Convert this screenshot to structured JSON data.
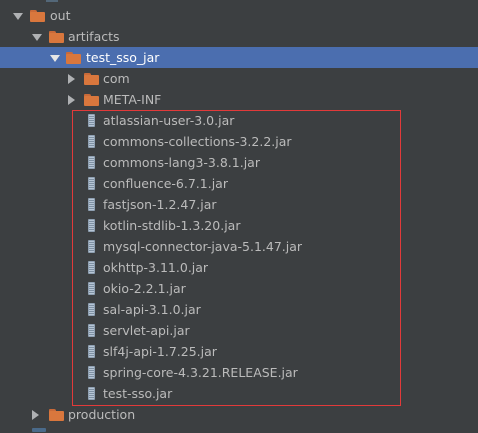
{
  "tree": {
    "out": {
      "label": "out",
      "icon": "folder-icon",
      "expanded": true
    },
    "artifacts": {
      "label": "artifacts",
      "icon": "folder-icon",
      "expanded": true
    },
    "test_sso_jar": {
      "label": "test_sso_jar",
      "icon": "folder-icon",
      "expanded": true,
      "selected": true
    },
    "com": {
      "label": "com",
      "icon": "folder-icon",
      "expanded": false
    },
    "meta_inf": {
      "label": "META-INF",
      "icon": "folder-icon",
      "expanded": false
    },
    "jars": [
      {
        "label": "atlassian-user-3.0.jar"
      },
      {
        "label": "commons-collections-3.2.2.jar"
      },
      {
        "label": "commons-lang3-3.8.1.jar"
      },
      {
        "label": "confluence-6.7.1.jar"
      },
      {
        "label": "fastjson-1.2.47.jar"
      },
      {
        "label": "kotlin-stdlib-1.3.20.jar"
      },
      {
        "label": "mysql-connector-java-5.1.47.jar"
      },
      {
        "label": "okhttp-3.11.0.jar"
      },
      {
        "label": "okio-2.2.1.jar"
      },
      {
        "label": "sal-api-3.1.0.jar"
      },
      {
        "label": "servlet-api.jar"
      },
      {
        "label": "slf4j-api-1.7.25.jar"
      },
      {
        "label": "spring-core-4.3.21.RELEASE.jar"
      },
      {
        "label": "test-sso.jar"
      }
    ],
    "production": {
      "label": "production",
      "icon": "folder-icon",
      "expanded": false
    }
  },
  "colors": {
    "background": "#3c3f41",
    "selection": "#4b6eaf",
    "text": "#bbbbbb",
    "folder": "#d9773d",
    "highlight_border": "#e23a3a"
  }
}
